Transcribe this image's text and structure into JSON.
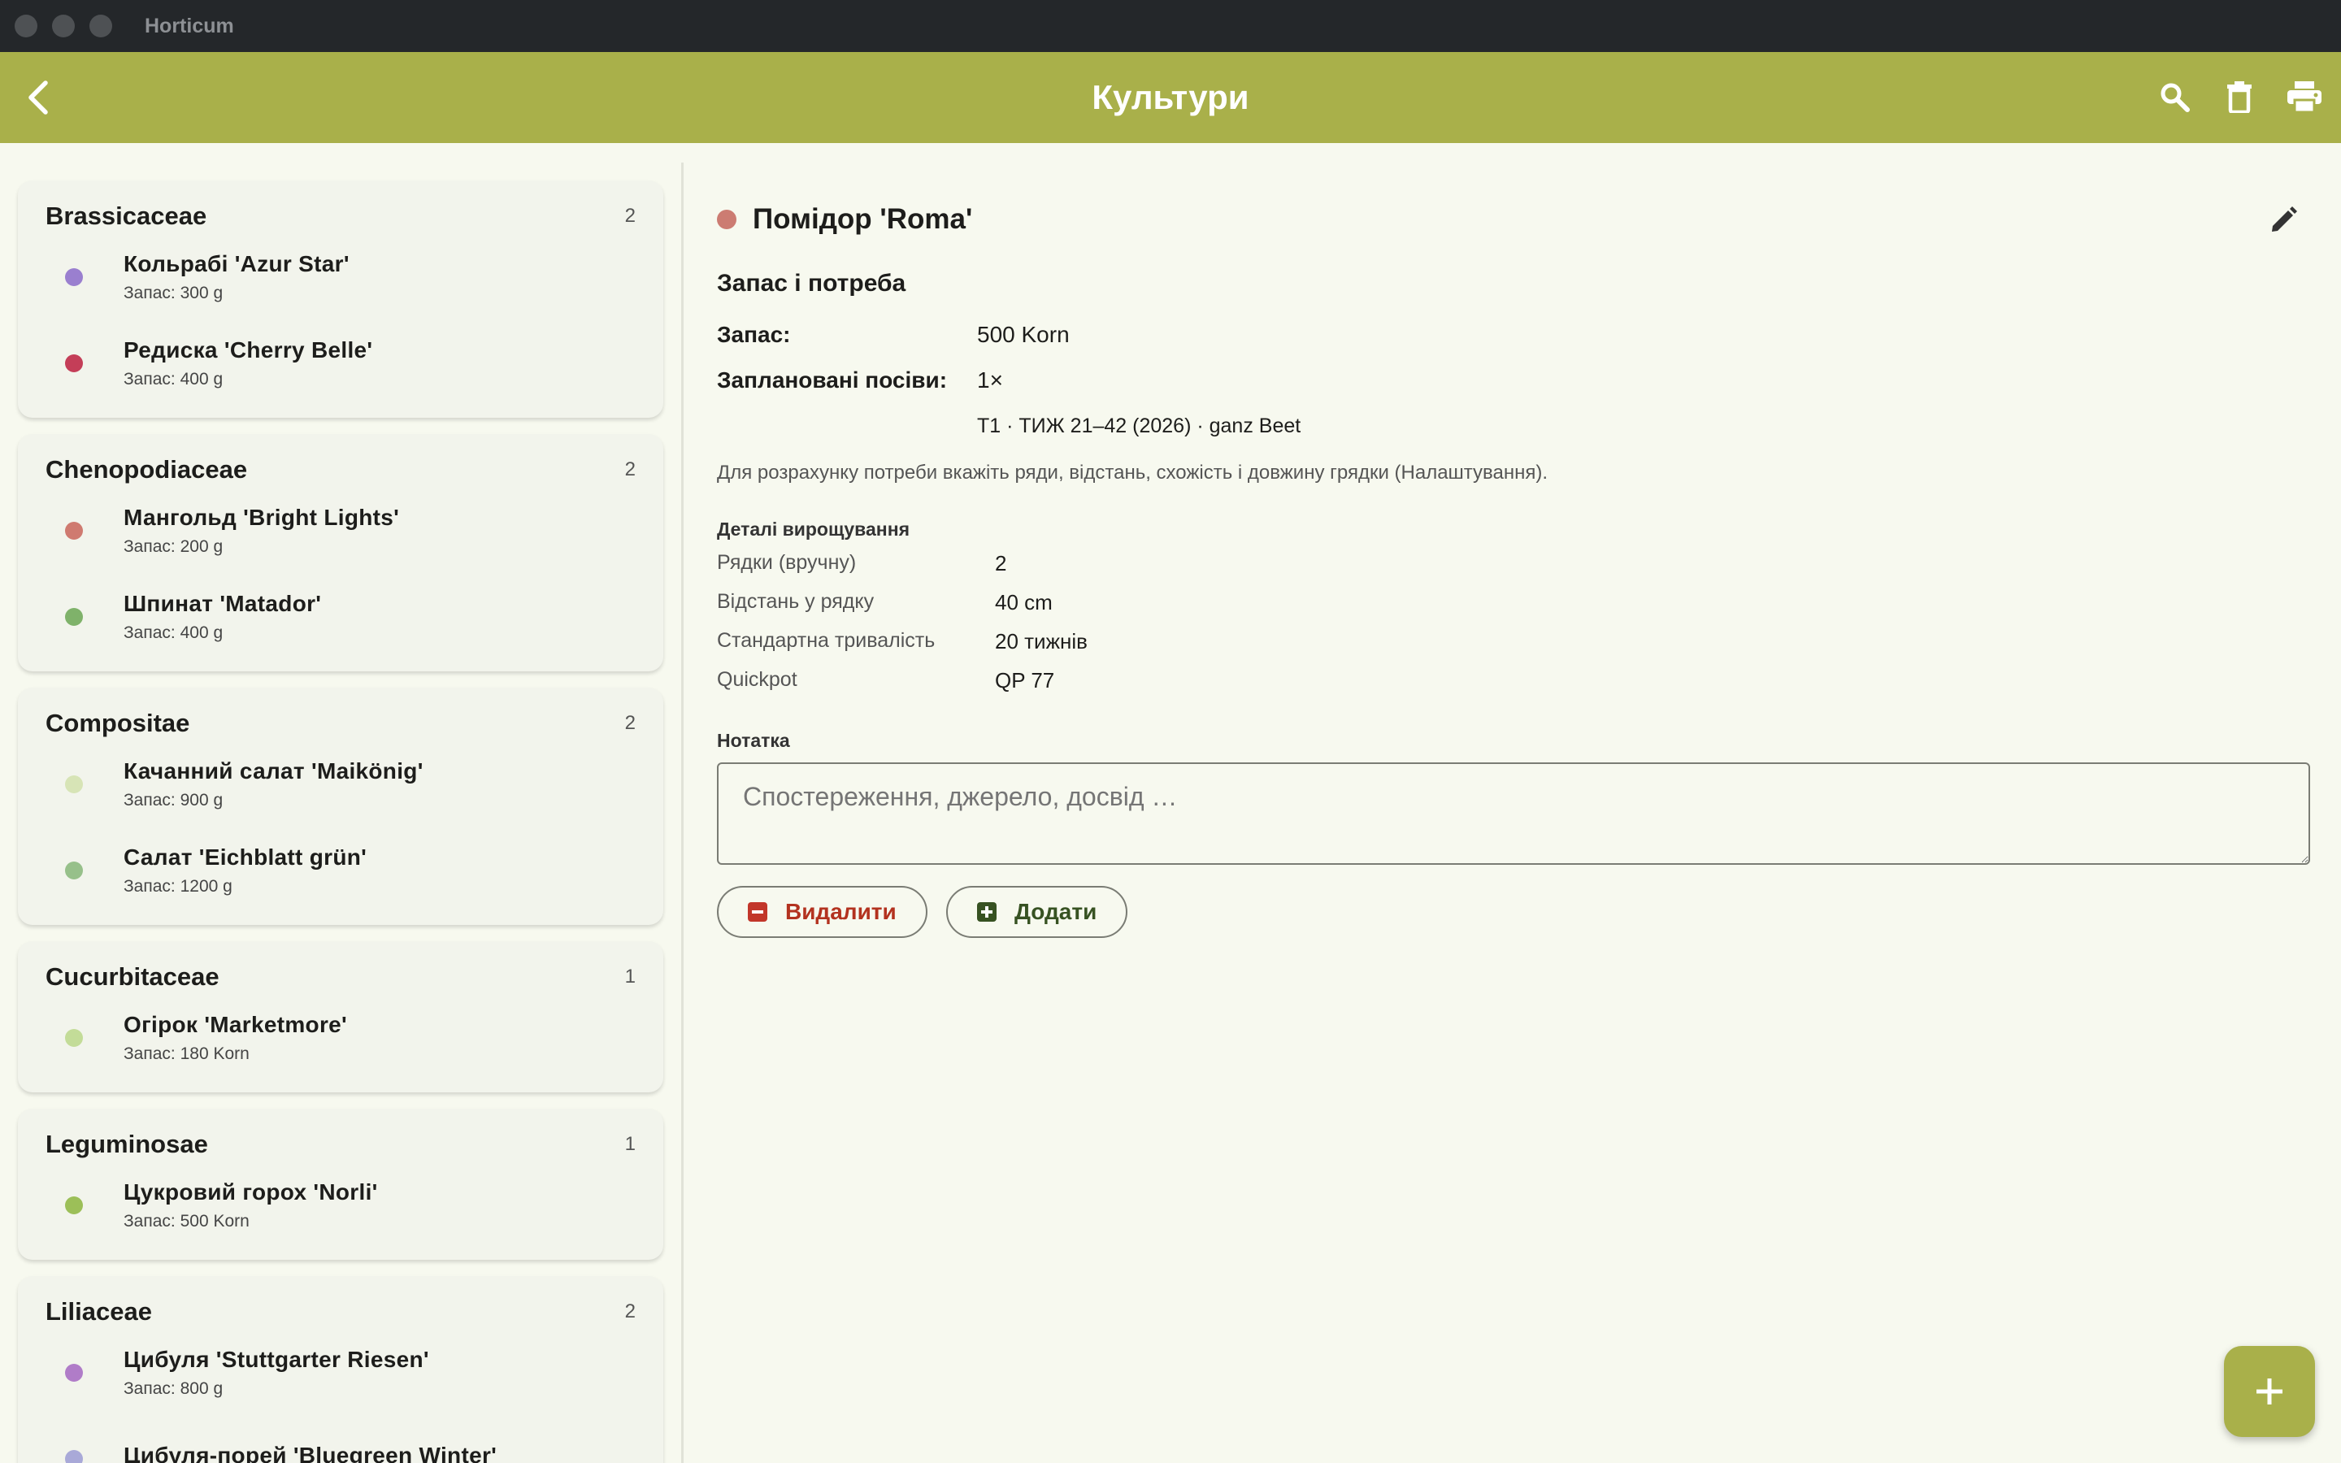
{
  "window": {
    "title": "Horticum"
  },
  "appbar": {
    "title": "Культури"
  },
  "groups": [
    {
      "name": "Brassicaceae",
      "count": "2",
      "items": [
        {
          "name": "Кольрабі 'Azur Star'",
          "stock": "Запас: 300 g",
          "color": "#9a7fcf"
        },
        {
          "name": "Редиска 'Cherry Belle'",
          "stock": "Запас: 400 g",
          "color": "#c43e58"
        }
      ]
    },
    {
      "name": "Chenopodiaceae",
      "count": "2",
      "items": [
        {
          "name": "Мангольд 'Bright Lights'",
          "stock": "Запас: 200 g",
          "color": "#cf7a70"
        },
        {
          "name": "Шпинат 'Matador'",
          "stock": "Запас: 400 g",
          "color": "#7fb26a"
        }
      ]
    },
    {
      "name": "Compositae",
      "count": "2",
      "items": [
        {
          "name": "Качанний салат 'Maikönig'",
          "stock": "Запас: 900 g",
          "color": "#d7e4b6"
        },
        {
          "name": "Салат 'Eichblatt grün'",
          "stock": "Запас: 1200 g",
          "color": "#97c08a"
        }
      ]
    },
    {
      "name": "Cucurbitaceae",
      "count": "1",
      "items": [
        {
          "name": "Огірок 'Marketmore'",
          "stock": "Запас: 180 Korn",
          "color": "#c3dc98"
        }
      ]
    },
    {
      "name": "Leguminosae",
      "count": "1",
      "items": [
        {
          "name": "Цукровий горох 'Norli'",
          "stock": "Запас: 500 Korn",
          "color": "#9cbf58"
        }
      ]
    },
    {
      "name": "Liliaceae",
      "count": "2",
      "items": [
        {
          "name": "Цибуля 'Stuttgarter Riesen'",
          "stock": "Запас: 800 g",
          "color": "#b07cc8"
        },
        {
          "name": "Цибуля-порей 'Bluegreen Winter'",
          "stock": "",
          "color": "#a9a9d8"
        }
      ]
    }
  ],
  "detail": {
    "title": "Помідор 'Roma'",
    "color": "#cc7c72",
    "section": "Запас і потреба",
    "stock_label": "Запас:",
    "stock_value": "500 Korn",
    "planned_label": "Заплановані посіви:",
    "planned_value": "1×",
    "planned_detail": "T1 · ТИЖ 21–42 (2026) · ganz Beet",
    "hint": "Для розрахунку потреби вкажіть ряди, відстань, схожість і довжину грядки (Налаштування).",
    "grow_title": "Деталі вирощування",
    "grow": [
      {
        "label": "Рядки (вручну)",
        "value": "2"
      },
      {
        "label": "Відстань у рядку",
        "value": "40 cm"
      },
      {
        "label": "Стандартна тривалість",
        "value": "20 тижнів"
      },
      {
        "label": "Quickpot",
        "value": "QP 77"
      }
    ],
    "note_label": "Нотатка",
    "note_placeholder": "Спостереження, джерело, досвід …",
    "delete_label": "Видалити",
    "add_label": "Додати"
  },
  "icons": {
    "back": "chevron-left-icon",
    "search": "search-icon",
    "delete": "trash-icon",
    "print": "printer-icon",
    "edit": "pencil-icon",
    "fab": "plus-icon"
  }
}
